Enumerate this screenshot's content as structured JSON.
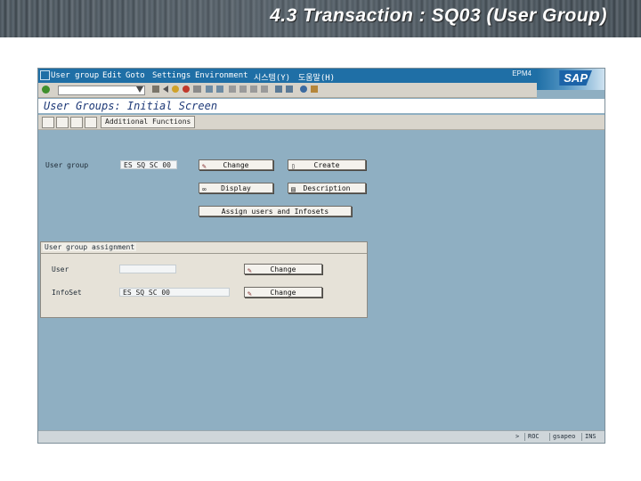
{
  "slide": {
    "title": "4.3 Transaction : SQ03 (User Group)"
  },
  "window": {
    "menu": [
      "User group",
      "Edit",
      "Goto",
      "Settings",
      "Environment",
      "시스템(Y)",
      "도움말(H)"
    ],
    "user_id": "EPM4",
    "logo_text": "SAP"
  },
  "screen": {
    "title": "User Groups: Initial Screen",
    "app_toolbar": {
      "additional_functions_label": "Additional Functions"
    }
  },
  "form": {
    "user_group_label": "User group",
    "user_group_value": "ES_SQ_SC_00",
    "buttons": {
      "change": "Change",
      "create": "Create",
      "display": "Display",
      "description": "Description",
      "assign": "Assign users and Infosets"
    }
  },
  "assignment_group": {
    "title": "User group assignment",
    "user_label": "User",
    "user_value": "",
    "infoset_label": "InfoSet",
    "infoset_value": "ES_SQ_SC_00",
    "change_label": "Change"
  },
  "status": {
    "arrow": ">",
    "system": "ROC",
    "server": "gsapeo",
    "mode": "INS"
  },
  "colors": {
    "menubar": "#1f6fa6",
    "screen_bg": "#8fafc2",
    "title_text": "#1f3a78"
  }
}
